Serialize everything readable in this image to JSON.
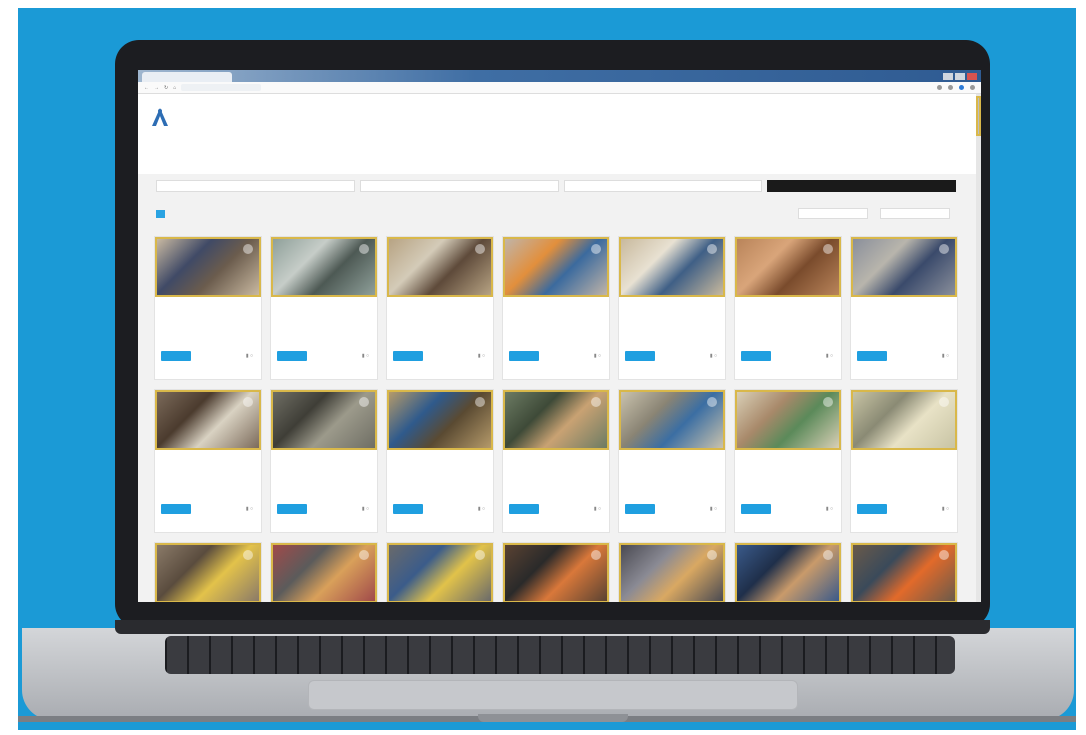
{
  "browser": {
    "tab_title": "",
    "url": ""
  },
  "org": {
    "name": ""
  },
  "nav": [],
  "filters": [],
  "pagination": {
    "pages": []
  },
  "sort": [],
  "cards": [
    {
      "title": "",
      "subtitle": "",
      "meta": "",
      "button": "",
      "colors": [
        "#c9b9a1",
        "#6b5c4d",
        "#404a66"
      ]
    },
    {
      "title": "",
      "subtitle": "",
      "meta": "",
      "button": "",
      "colors": [
        "#8fa09a",
        "#4d5954",
        "#c6cdc8"
      ]
    },
    {
      "title": "",
      "subtitle": "",
      "meta": "",
      "button": "",
      "colors": [
        "#b7a383",
        "#5e4a3a",
        "#d4cbb8"
      ]
    },
    {
      "title": "",
      "subtitle": "",
      "meta": "",
      "button": "",
      "colors": [
        "#c0b4a8",
        "#3b6a9e",
        "#e28f3c"
      ]
    },
    {
      "title": "",
      "subtitle": "",
      "meta": "",
      "button": "",
      "colors": [
        "#c8b99d",
        "#3f5f86",
        "#e8e1d2"
      ]
    },
    {
      "title": "",
      "subtitle": "",
      "meta": "",
      "button": "",
      "colors": [
        "#b9845a",
        "#7a4b2c",
        "#d9a57a"
      ]
    },
    {
      "title": "",
      "subtitle": "",
      "meta": "",
      "button": "",
      "colors": [
        "#8a8f9b",
        "#3a4a6b",
        "#b8b5ac"
      ]
    },
    {
      "title": "",
      "subtitle": "",
      "meta": "",
      "button": "",
      "colors": [
        "#7b6a5a",
        "#d9d2c2",
        "#4b3b2e"
      ]
    },
    {
      "title": "",
      "subtitle": "",
      "meta": "",
      "button": "",
      "colors": [
        "#6f6e64",
        "#9c9a8b",
        "#3f3e37"
      ]
    },
    {
      "title": "",
      "subtitle": "",
      "meta": "",
      "button": "",
      "colors": [
        "#b59a6a",
        "#5a4a32",
        "#2f5a8c"
      ]
    },
    {
      "title": "",
      "subtitle": "",
      "meta": "",
      "button": "",
      "colors": [
        "#6c7b63",
        "#c9a273",
        "#3e4a38"
      ]
    },
    {
      "title": "",
      "subtitle": "",
      "meta": "",
      "button": "",
      "colors": [
        "#c9c2ad",
        "#3b6ea3",
        "#8a8474"
      ]
    },
    {
      "title": "",
      "subtitle": "",
      "meta": "",
      "button": "",
      "colors": [
        "#d9cfb6",
        "#5b8a5a",
        "#a8896a"
      ]
    },
    {
      "title": "",
      "subtitle": "",
      "meta": "",
      "button": "",
      "colors": [
        "#c8c4a4",
        "#e8e2c6",
        "#8a8a74"
      ]
    },
    {
      "title": "",
      "subtitle": "",
      "meta": "",
      "button": "",
      "colors": [
        "#8a7a68",
        "#e3c24a",
        "#5a4c3e"
      ]
    },
    {
      "title": "",
      "subtitle": "",
      "meta": "",
      "button": "",
      "colors": [
        "#a04a4a",
        "#d9a05a",
        "#5b5b5b"
      ]
    },
    {
      "title": "",
      "subtitle": "",
      "meta": "",
      "button": "",
      "colors": [
        "#6a6a6a",
        "#e1c24a",
        "#3b5c8a"
      ]
    },
    {
      "title": "",
      "subtitle": "",
      "meta": "",
      "button": "",
      "colors": [
        "#5a4232",
        "#d9783a",
        "#2a2a2a"
      ]
    },
    {
      "title": "",
      "subtitle": "",
      "meta": "",
      "button": "",
      "colors": [
        "#4a4a52",
        "#d9a862",
        "#8a8a94"
      ]
    },
    {
      "title": "",
      "subtitle": "",
      "meta": "",
      "button": "",
      "colors": [
        "#3a5a8a",
        "#c99a6a",
        "#1f2f4a"
      ]
    },
    {
      "title": "",
      "subtitle": "",
      "meta": "",
      "button": "",
      "colors": [
        "#6a5a4a",
        "#e26a2a",
        "#3a4a5a"
      ]
    }
  ]
}
